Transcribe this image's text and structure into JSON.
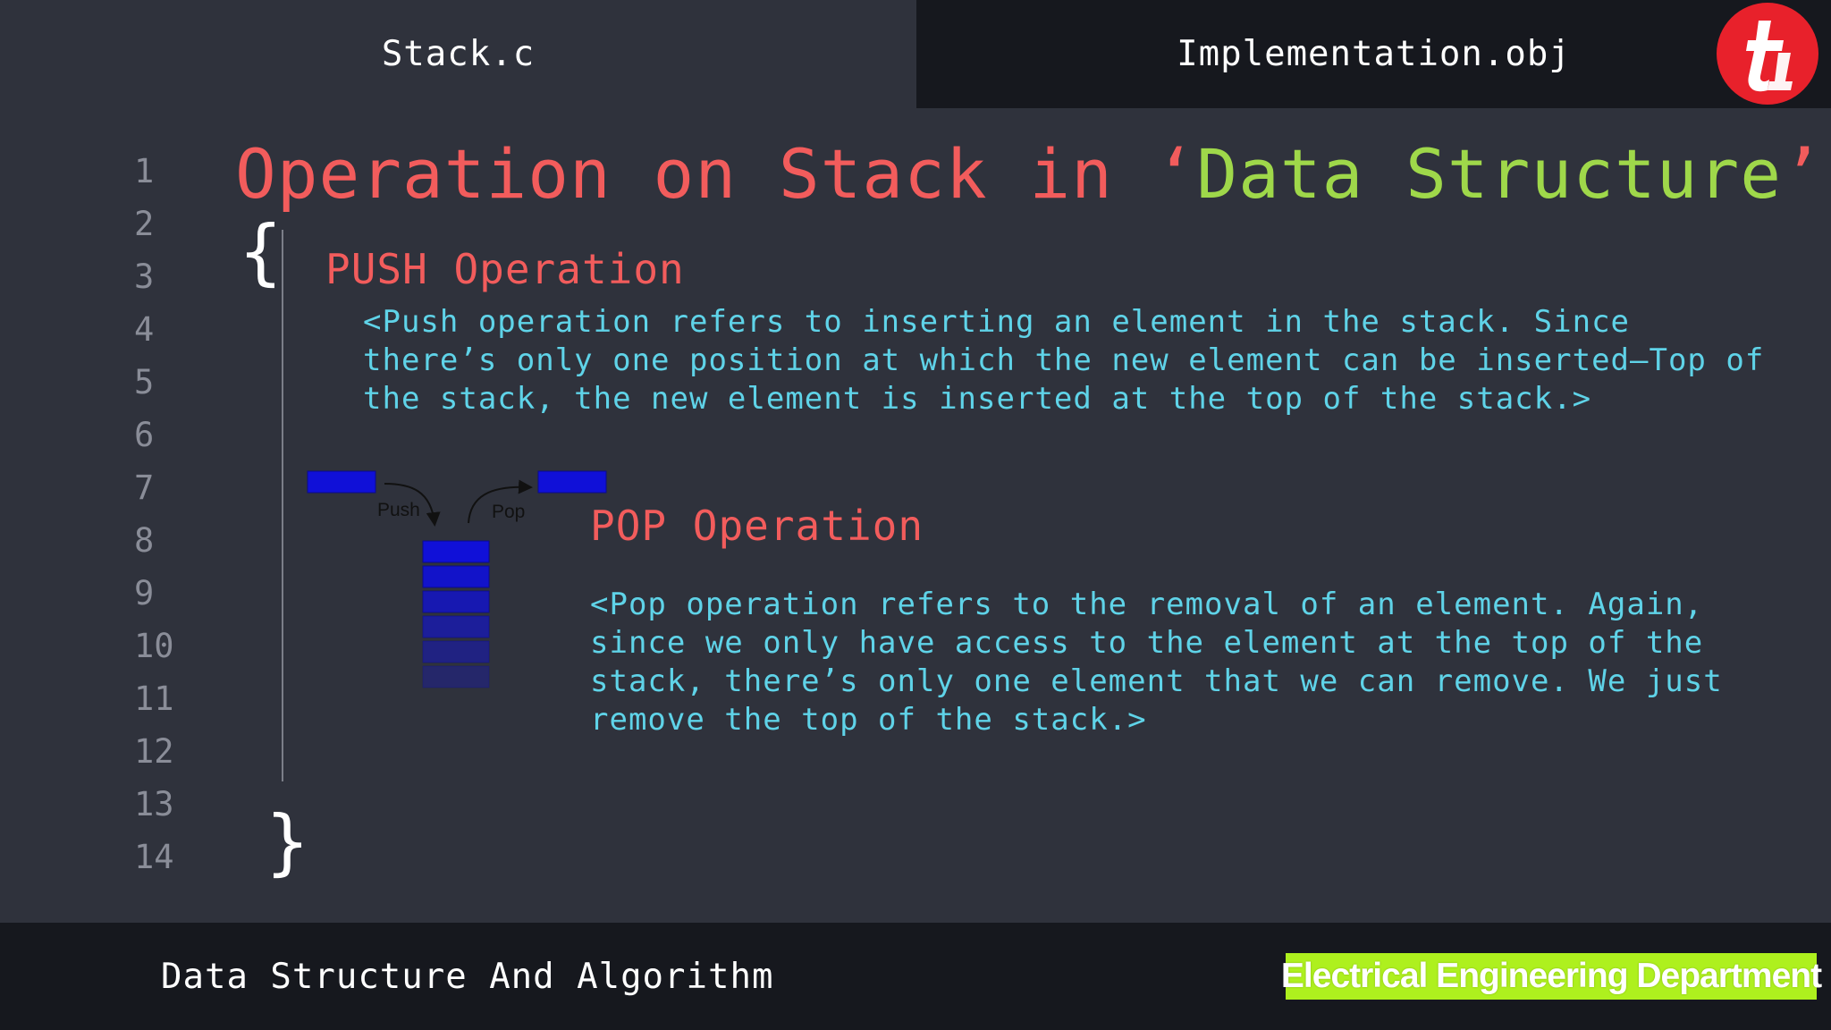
{
  "tabs": [
    {
      "label": "Stack.c",
      "active": true
    },
    {
      "label": "Implementation.obj",
      "active": false
    }
  ],
  "line_numbers": [
    "1",
    "2",
    "3",
    "4",
    "5",
    "6",
    "7",
    "8",
    "9",
    "10",
    "11",
    "12",
    "13",
    "14"
  ],
  "title": {
    "part1": "Operation on Stack in ‘",
    "part2": "Data Structure",
    "part3": "’"
  },
  "braces": {
    "open": "{",
    "close": "}"
  },
  "push": {
    "heading": "PUSH Operation",
    "lines": [
      "<Push operation refers to inserting an element in the stack. Since",
      "there’s only one position at which the new element can be inserted—Top of",
      "the stack, the new element is inserted at the top of the stack.>"
    ]
  },
  "pop": {
    "heading": "POP Operation",
    "lines": [
      "<Pop operation refers to the removal of an element. Again,",
      "since we only have access to the element at the top of the",
      "stack, there’s only one element that we can remove. We just",
      "remove the top of the stack.>"
    ]
  },
  "diagram": {
    "push_label": "Push",
    "pop_label": "Pop",
    "stack_fill_levels": [
      1.0,
      0.9,
      0.75,
      0.6,
      0.45,
      0.3
    ]
  },
  "footer": {
    "left_text": "Data Structure And Algorithm",
    "badge_text": "Electrical Engineering Department"
  },
  "colors": {
    "background": "#2f323c",
    "tab_inactive": "#16181e",
    "keyword_red": "#f25c5c",
    "string_green": "#9fd84a",
    "comment_cyan": "#5fd3e8",
    "badge_green": "#aef01e",
    "logo_red": "#e8212b",
    "block_blue": "#1010d8"
  },
  "logo_icon": "t4-logo"
}
